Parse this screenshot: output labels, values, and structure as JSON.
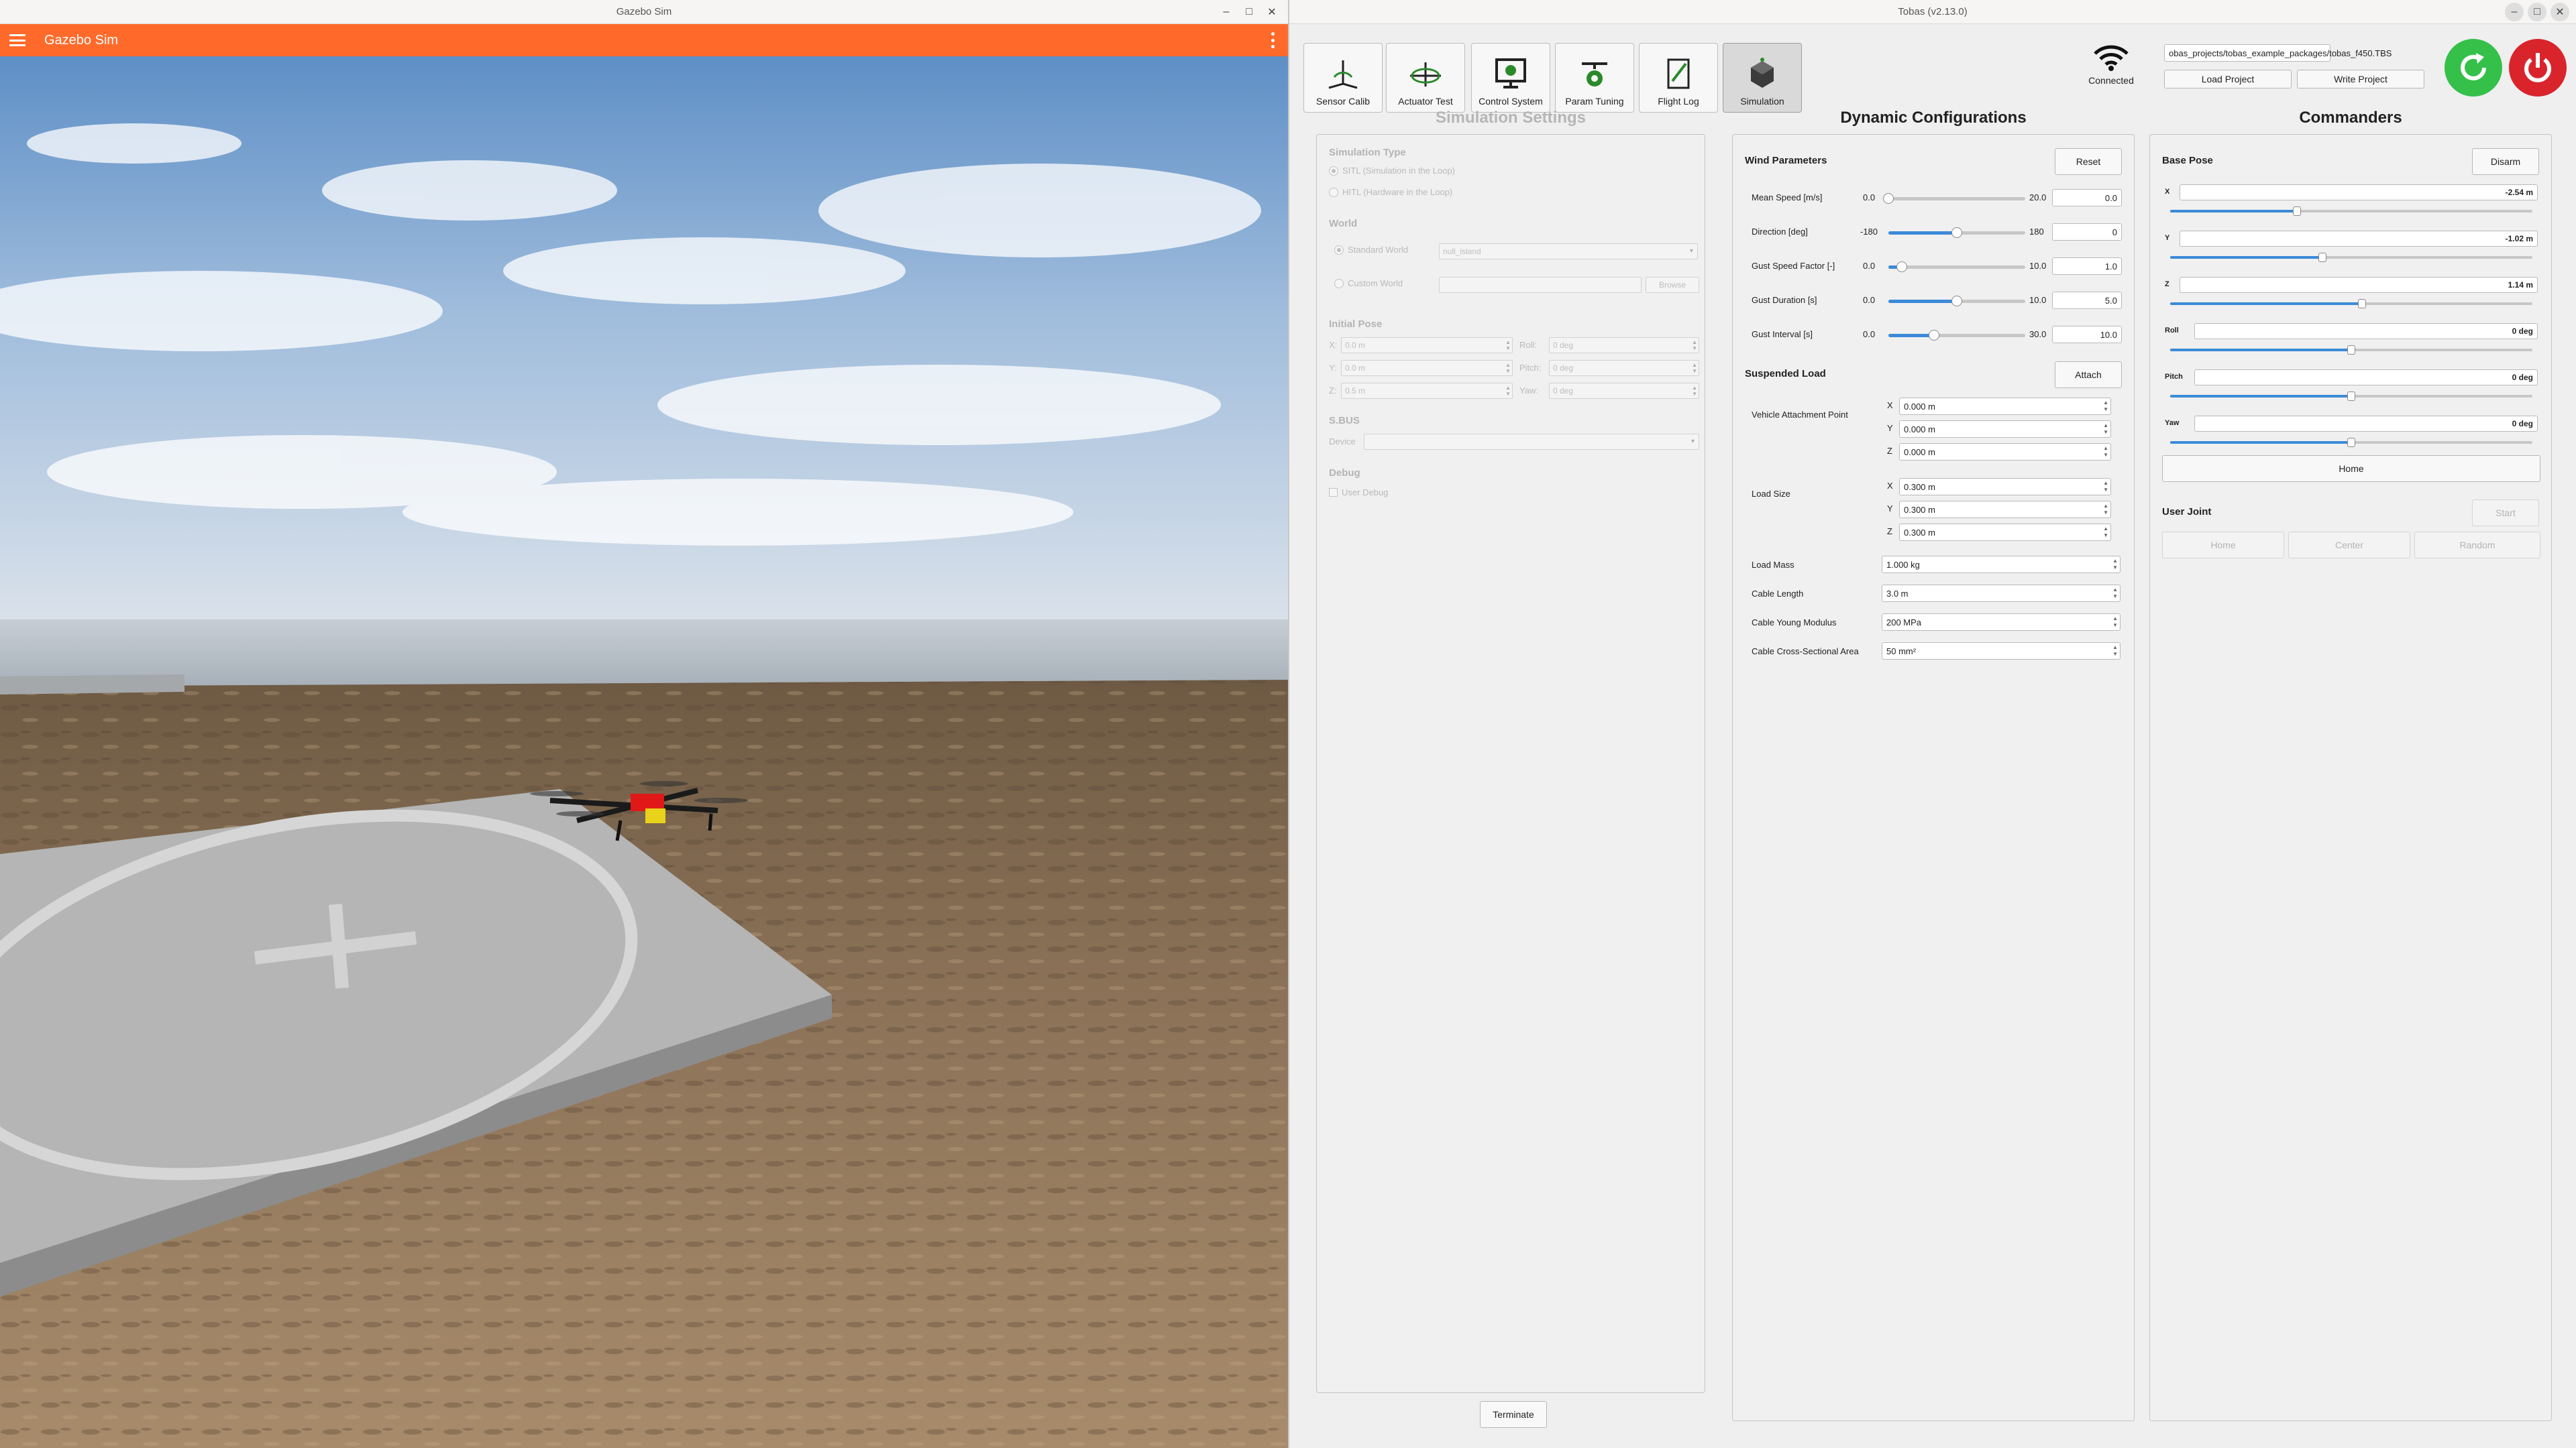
{
  "gazebo": {
    "window_title": "Gazebo Sim",
    "app_title": "Gazebo Sim"
  },
  "tobas": {
    "window_title": "Tobas (v2.13.0)",
    "toolbar": [
      {
        "label": "Sensor Calib",
        "icon": "sensor-calib-icon"
      },
      {
        "label": "Actuator Test",
        "icon": "actuator-test-icon"
      },
      {
        "label": "Control System",
        "icon": "control-system-icon"
      },
      {
        "label": "Param Tuning",
        "icon": "param-tuning-icon"
      },
      {
        "label": "Flight Log",
        "icon": "flight-log-icon"
      },
      {
        "label": "Simulation",
        "icon": "simulation-icon"
      }
    ],
    "connection_status": "Connected",
    "project_path": "obas_projects/tobas_example_packages/tobas_f450.TBS",
    "load_project": "Load Project",
    "write_project": "Write Project",
    "colors": {
      "start": "#35c04a",
      "stop": "#d9242c",
      "accent": "#3c8ad9"
    }
  },
  "sim_settings": {
    "title": "Simulation Settings",
    "simulation_type": "Simulation Type",
    "sitl": "SITL (Simulation in the Loop)",
    "hitl": "HITL (Hardware in the Loop)",
    "world": "World",
    "standard_world": "Standard World",
    "standard_world_value": "null_island",
    "custom_world": "Custom World",
    "browse": "Browse",
    "initial_pose": "Initial Pose",
    "pose": [
      {
        "label": "X:",
        "value": "0.0 m",
        "label2": "Roll:",
        "value2": "0 deg"
      },
      {
        "label": "Y:",
        "value": "0.0 m",
        "label2": "Pitch:",
        "value2": "0 deg"
      },
      {
        "label": "Z:",
        "value": "0.5 m",
        "label2": "Yaw:",
        "value2": "0 deg"
      }
    ],
    "sbus": "S.BUS",
    "device": "Device",
    "debug": "Debug",
    "user_debug": "User Debug",
    "terminate": "Terminate"
  },
  "dynamic": {
    "title": "Dynamic Configurations",
    "wind_parameters": "Wind Parameters",
    "reset": "Reset",
    "wind": [
      {
        "label": "Mean Speed [m/s]",
        "min": "0.0",
        "max": "20.0",
        "value": "0.0",
        "fraction": 0.0
      },
      {
        "label": "Direction [deg]",
        "min": "-180",
        "max": "180",
        "value": "0",
        "fraction": 0.5
      },
      {
        "label": "Gust Speed Factor [-]",
        "min": "0.0",
        "max": "10.0",
        "value": "1.0",
        "fraction": 0.1
      },
      {
        "label": "Gust Duration [s]",
        "min": "0.0",
        "max": "10.0",
        "value": "5.0",
        "fraction": 0.5
      },
      {
        "label": "Gust Interval [s]",
        "min": "0.0",
        "max": "30.0",
        "value": "10.0",
        "fraction": 0.333
      }
    ],
    "suspended_load": "Suspended Load",
    "attach": "Attach",
    "vehicle_attachment_point": "Vehicle Attachment Point",
    "attach_xyz": [
      {
        "axis": "X",
        "value": "0.000 m"
      },
      {
        "axis": "Y",
        "value": "0.000 m"
      },
      {
        "axis": "Z",
        "value": "0.000 m"
      }
    ],
    "load_size": "Load Size",
    "size_xyz": [
      {
        "axis": "X",
        "value": "0.300 m"
      },
      {
        "axis": "Y",
        "value": "0.300 m"
      },
      {
        "axis": "Z",
        "value": "0.300 m"
      }
    ],
    "params": [
      {
        "label": "Load Mass",
        "value": "1.000 kg"
      },
      {
        "label": "Cable Length",
        "value": "3.0 m"
      },
      {
        "label": "Cable Young Modulus",
        "value": "200 MPa"
      },
      {
        "label": "Cable Cross-Sectional Area",
        "value": "50 mm²"
      }
    ]
  },
  "commanders": {
    "title": "Commanders",
    "base_pose": "Base Pose",
    "disarm": "Disarm",
    "axes": [
      {
        "label": "X",
        "value": "-2.54 m",
        "fraction": 0.35
      },
      {
        "label": "Y",
        "value": "-1.02 m",
        "fraction": 0.42
      },
      {
        "label": "Z",
        "value": "1.14 m",
        "fraction": 0.53
      },
      {
        "label": "Roll",
        "value": "0 deg",
        "fraction": 0.5
      },
      {
        "label": "Pitch",
        "value": "0 deg",
        "fraction": 0.5
      },
      {
        "label": "Yaw",
        "value": "0 deg",
        "fraction": 0.5
      }
    ],
    "home": "Home",
    "user_joint": "User Joint",
    "start": "Start",
    "joint_buttons": [
      "Home",
      "Center",
      "Random"
    ]
  }
}
